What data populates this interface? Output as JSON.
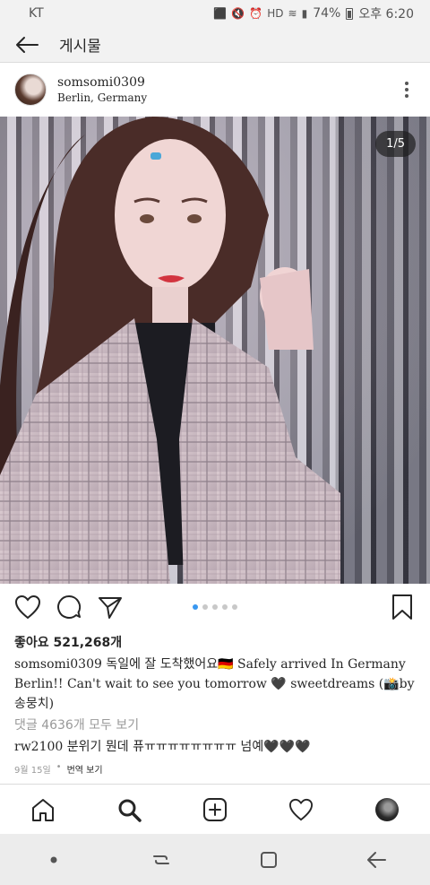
{
  "status_bar": {
    "carrier": "KT",
    "battery_percent": "74%",
    "time": "오후 6:20"
  },
  "header": {
    "title": "게시물",
    "back_icon": "arrow-left-icon"
  },
  "post": {
    "username": "somsomi0309",
    "location": "Berlin, Germany",
    "more_icon": "vertical-dots-icon",
    "photo_counter": "1/5",
    "carousel": {
      "total": 5,
      "active_index": 0
    },
    "likes": "좋아요 521,268개",
    "caption_username": "somsomi0309",
    "caption_text": "독일에 잘 도착했어요🇩🇪 Safely arrived In Germany Berlin!! Can't wait to see you tomorrow 🖤 sweetdreams (📸by송뭉치)",
    "view_comments": "댓글 4636개 모두 보기",
    "comment_username": "rw2100",
    "comment_text": "분위기 뭔데 퓨ㅠㅠㅠㅠㅠㅠㅠㅠ 넘예🖤🖤🖤",
    "date": "9월 15일",
    "separator": "•",
    "translate": "번역 보기"
  },
  "actions": {
    "like_icon": "heart-icon",
    "comment_icon": "comment-icon",
    "share_icon": "send-icon",
    "bookmark_icon": "bookmark-icon"
  },
  "bottom_nav": [
    "home-icon",
    "search-icon",
    "add-icon",
    "heart-icon",
    "profile-avatar"
  ],
  "colors": {
    "accent": "#3897f0",
    "text": "#262626",
    "muted": "#999999"
  }
}
